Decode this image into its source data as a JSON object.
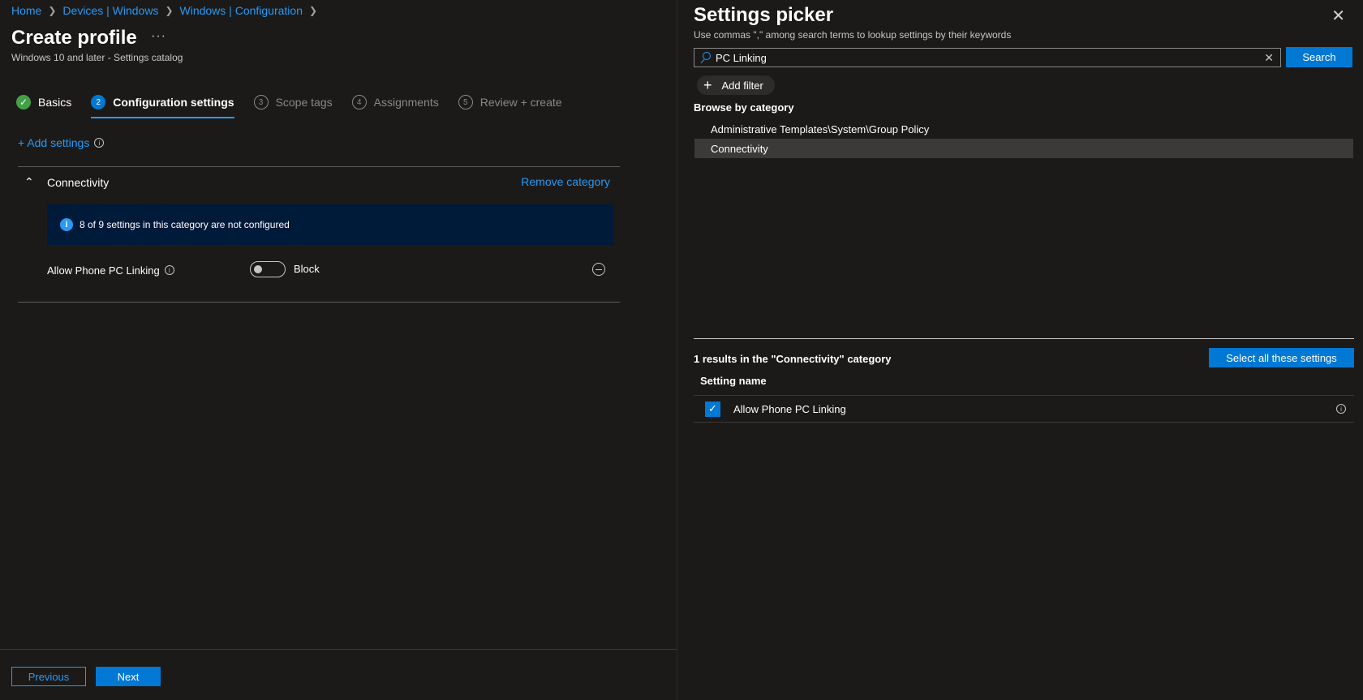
{
  "breadcrumb": [
    "Home",
    "Devices | Windows",
    "Windows | Configuration"
  ],
  "page": {
    "title": "Create profile",
    "more": "···",
    "subtitle": "Windows 10 and later - Settings catalog"
  },
  "wizard": {
    "steps": [
      {
        "num": "✓",
        "label": "Basics",
        "state": "done"
      },
      {
        "num": "2",
        "label": "Configuration settings",
        "state": "active"
      },
      {
        "num": "3",
        "label": "Scope tags",
        "state": "pending"
      },
      {
        "num": "4",
        "label": "Assignments",
        "state": "pending"
      },
      {
        "num": "5",
        "label": "Review + create",
        "state": "pending"
      }
    ]
  },
  "add_settings": "+ Add settings",
  "category": {
    "name": "Connectivity",
    "remove_label": "Remove category",
    "notice": "8 of 9 settings in this category are not configured",
    "setting": {
      "name": "Allow Phone PC Linking",
      "toggle_value": "Block"
    }
  },
  "footer": {
    "previous": "Previous",
    "next": "Next"
  },
  "picker": {
    "title": "Settings picker",
    "hint": "Use commas \",\" among search terms to lookup settings by their keywords",
    "search_value": "PC Linking",
    "search_button": "Search",
    "add_filter": "Add filter",
    "browse_label": "Browse by category",
    "categories": [
      {
        "label": "Administrative Templates\\System\\Group Policy",
        "selected": false
      },
      {
        "label": "Connectivity",
        "selected": true
      }
    ],
    "results_label": "1 results in the \"Connectivity\" category",
    "select_all": "Select all these settings",
    "column_header": "Setting name",
    "results": [
      {
        "name": "Allow Phone PC Linking",
        "checked": true
      }
    ]
  }
}
